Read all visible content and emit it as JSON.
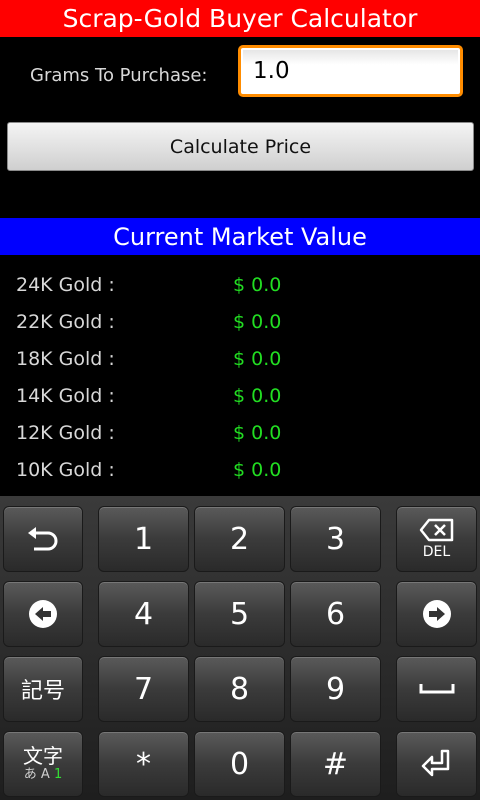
{
  "app": {
    "title": "Scrap-Gold Buyer Calculator"
  },
  "form": {
    "grams_label": "Grams To Purchase:",
    "grams_value": "1.0",
    "calculate_label": "Calculate Price"
  },
  "market": {
    "header": "Current Market Value",
    "rows": [
      {
        "label": "24K Gold :",
        "value": "$ 0.0"
      },
      {
        "label": "22K Gold :",
        "value": "$ 0.0"
      },
      {
        "label": "18K Gold :",
        "value": "$ 0.0"
      },
      {
        "label": "14K Gold :",
        "value": "$ 0.0"
      },
      {
        "label": "12K Gold :",
        "value": "$ 0.0"
      },
      {
        "label": "10K Gold :",
        "value": "$ 0.0"
      }
    ]
  },
  "keyboard": {
    "digits": [
      "1",
      "2",
      "3",
      "4",
      "5",
      "6",
      "7",
      "8",
      "9",
      "*",
      "0",
      "#"
    ],
    "symbols_label": "記号",
    "del_label": "DEL",
    "moji_top": "文字",
    "moji_bottom_kana": "あ A ",
    "moji_bottom_one": "1"
  },
  "colors": {
    "title_bar": "#ff0000",
    "market_header": "#0000ff",
    "value_text": "#22dd22",
    "input_focus": "#ff8c00"
  }
}
